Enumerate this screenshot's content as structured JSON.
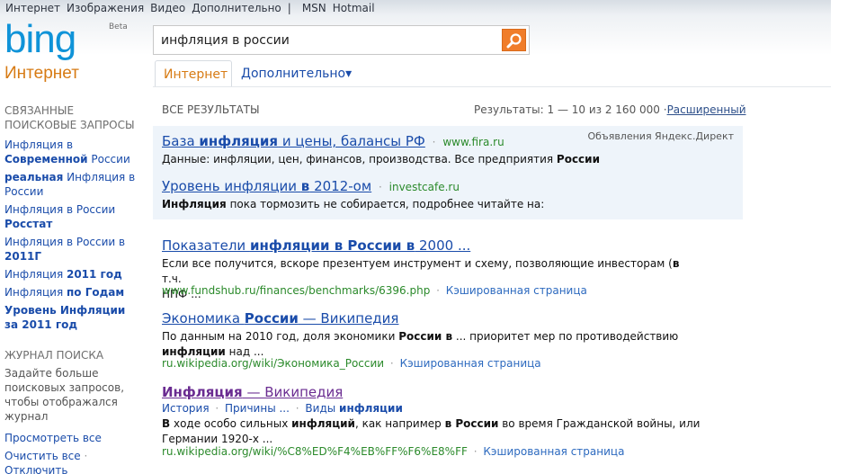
{
  "topnav": {
    "items": [
      "Интернет",
      "Изображения",
      "Видео",
      "Дополнительно"
    ],
    "separator": "|",
    "extra": [
      "MSN",
      "Hotmail"
    ]
  },
  "logo": {
    "text": "bing",
    "beta": "Beta"
  },
  "section_title": "Интернет",
  "search": {
    "value": "инфляция в россии"
  },
  "tabs": {
    "active": "Интернет",
    "more": "Дополнительно▾"
  },
  "left": {
    "related_heading": "СВЯЗАННЫЕ ПОИСКОВЫЕ ЗАПРОСЫ",
    "related": [
      {
        "pre": "Инфляция в ",
        "bold": "Современной",
        "post": " России"
      },
      {
        "pre": "",
        "bold": "реальная",
        "post": " Инфляция в России"
      },
      {
        "pre": "Инфляция в России ",
        "bold": "Росстат",
        "post": ""
      },
      {
        "pre": "Инфляция в России в ",
        "bold": "2011Г",
        "post": ""
      },
      {
        "pre": "Инфляция ",
        "bold": "2011 год",
        "post": ""
      },
      {
        "pre": "Инфляция ",
        "bold": "по Годам",
        "post": ""
      },
      {
        "pre": "",
        "bold": "Уровень Инфляции за 2011 год",
        "post": ""
      }
    ],
    "history_heading": "ЖУРНАЛ ПОИСКА",
    "history_text": "Задайте больше поисковых запросов, чтобы отображался журнал",
    "view_all": "Просмотреть все",
    "clear_all": "Очистить все",
    "clear_sep": "·",
    "disable": "Отключить"
  },
  "results_header": {
    "label": "ВСЕ РЕЗУЛЬТАТЫ",
    "count": "Результаты: 1 — 10 из 2 160 000 ·",
    "advanced": "Расширенный"
  },
  "ads": {
    "label": "Объявления Яндекс.Директ",
    "items": [
      {
        "t_pre": "База ",
        "t_bold": "инфляция",
        "t_post": " и цены, балансы РФ",
        "dot": "·",
        "url": "www.fira.ru",
        "d_pre": "Данные: инфляции, цен, финансов, производства. Все предприятия ",
        "d_bold": "России",
        "d_post": ""
      },
      {
        "t_pre": "Уровень инфляции ",
        "t_bold": "в",
        "t_post": " 2012-ом",
        "dot": "·",
        "url": "investcafe.ru",
        "d_pre": "",
        "d_bold": "Инфляция",
        "d_post": " пока тормозить не собирается, подробнее читайте на:"
      }
    ]
  },
  "results": [
    {
      "t_pre": "Показатели ",
      "t_bold": "инфляции в России в",
      "t_post": " 2000 ...",
      "line1_pre": "Если все получится, вскоре презентуем инструмент и схему, позволяющие инвесторам (",
      "line1_bold": "в",
      "line1_post": " т.ч.",
      "line2": "НПФ ...",
      "url": "www.fundshub.ru/finances/benchmarks/6396.php",
      "sep": "·",
      "cache": "Кэшированная страница"
    },
    {
      "t_pre": "Экономика ",
      "t_bold": "России",
      "t_post": " — Википедия",
      "line1_pre": "По данным на 2010 год, доля экономики ",
      "line1_bold": "России в",
      "line1_post": " ... приоритет мер по противодействию",
      "line2_bold": "инфляции",
      "line2_post": " над ...",
      "url": "ru.wikipedia.org/wiki/Экономика_России",
      "sep": "·",
      "cache": "Кэшированная страница"
    },
    {
      "t_bold": "Инфляция",
      "t_post": " — Википедия",
      "sub1": "История",
      "sub2": "Причины ...",
      "sub3_pre": "Виды ",
      "sub3_bold": "инфляции",
      "sub_dot": "·",
      "line1_b1": "В",
      "line1_m1": " ходе особо сильных ",
      "line1_b2": "инфляций",
      "line1_m2": ", как например ",
      "line1_b3": "в России",
      "line1_m3": " во время Гражданской войны, или",
      "line2": "Германии 1920-х ...",
      "url": "ru.wikipedia.org/wiki/%C8%ED%F4%EB%FF%F6%E8%FF",
      "sep": "·",
      "cache": "Кэшированная страница"
    }
  ]
}
